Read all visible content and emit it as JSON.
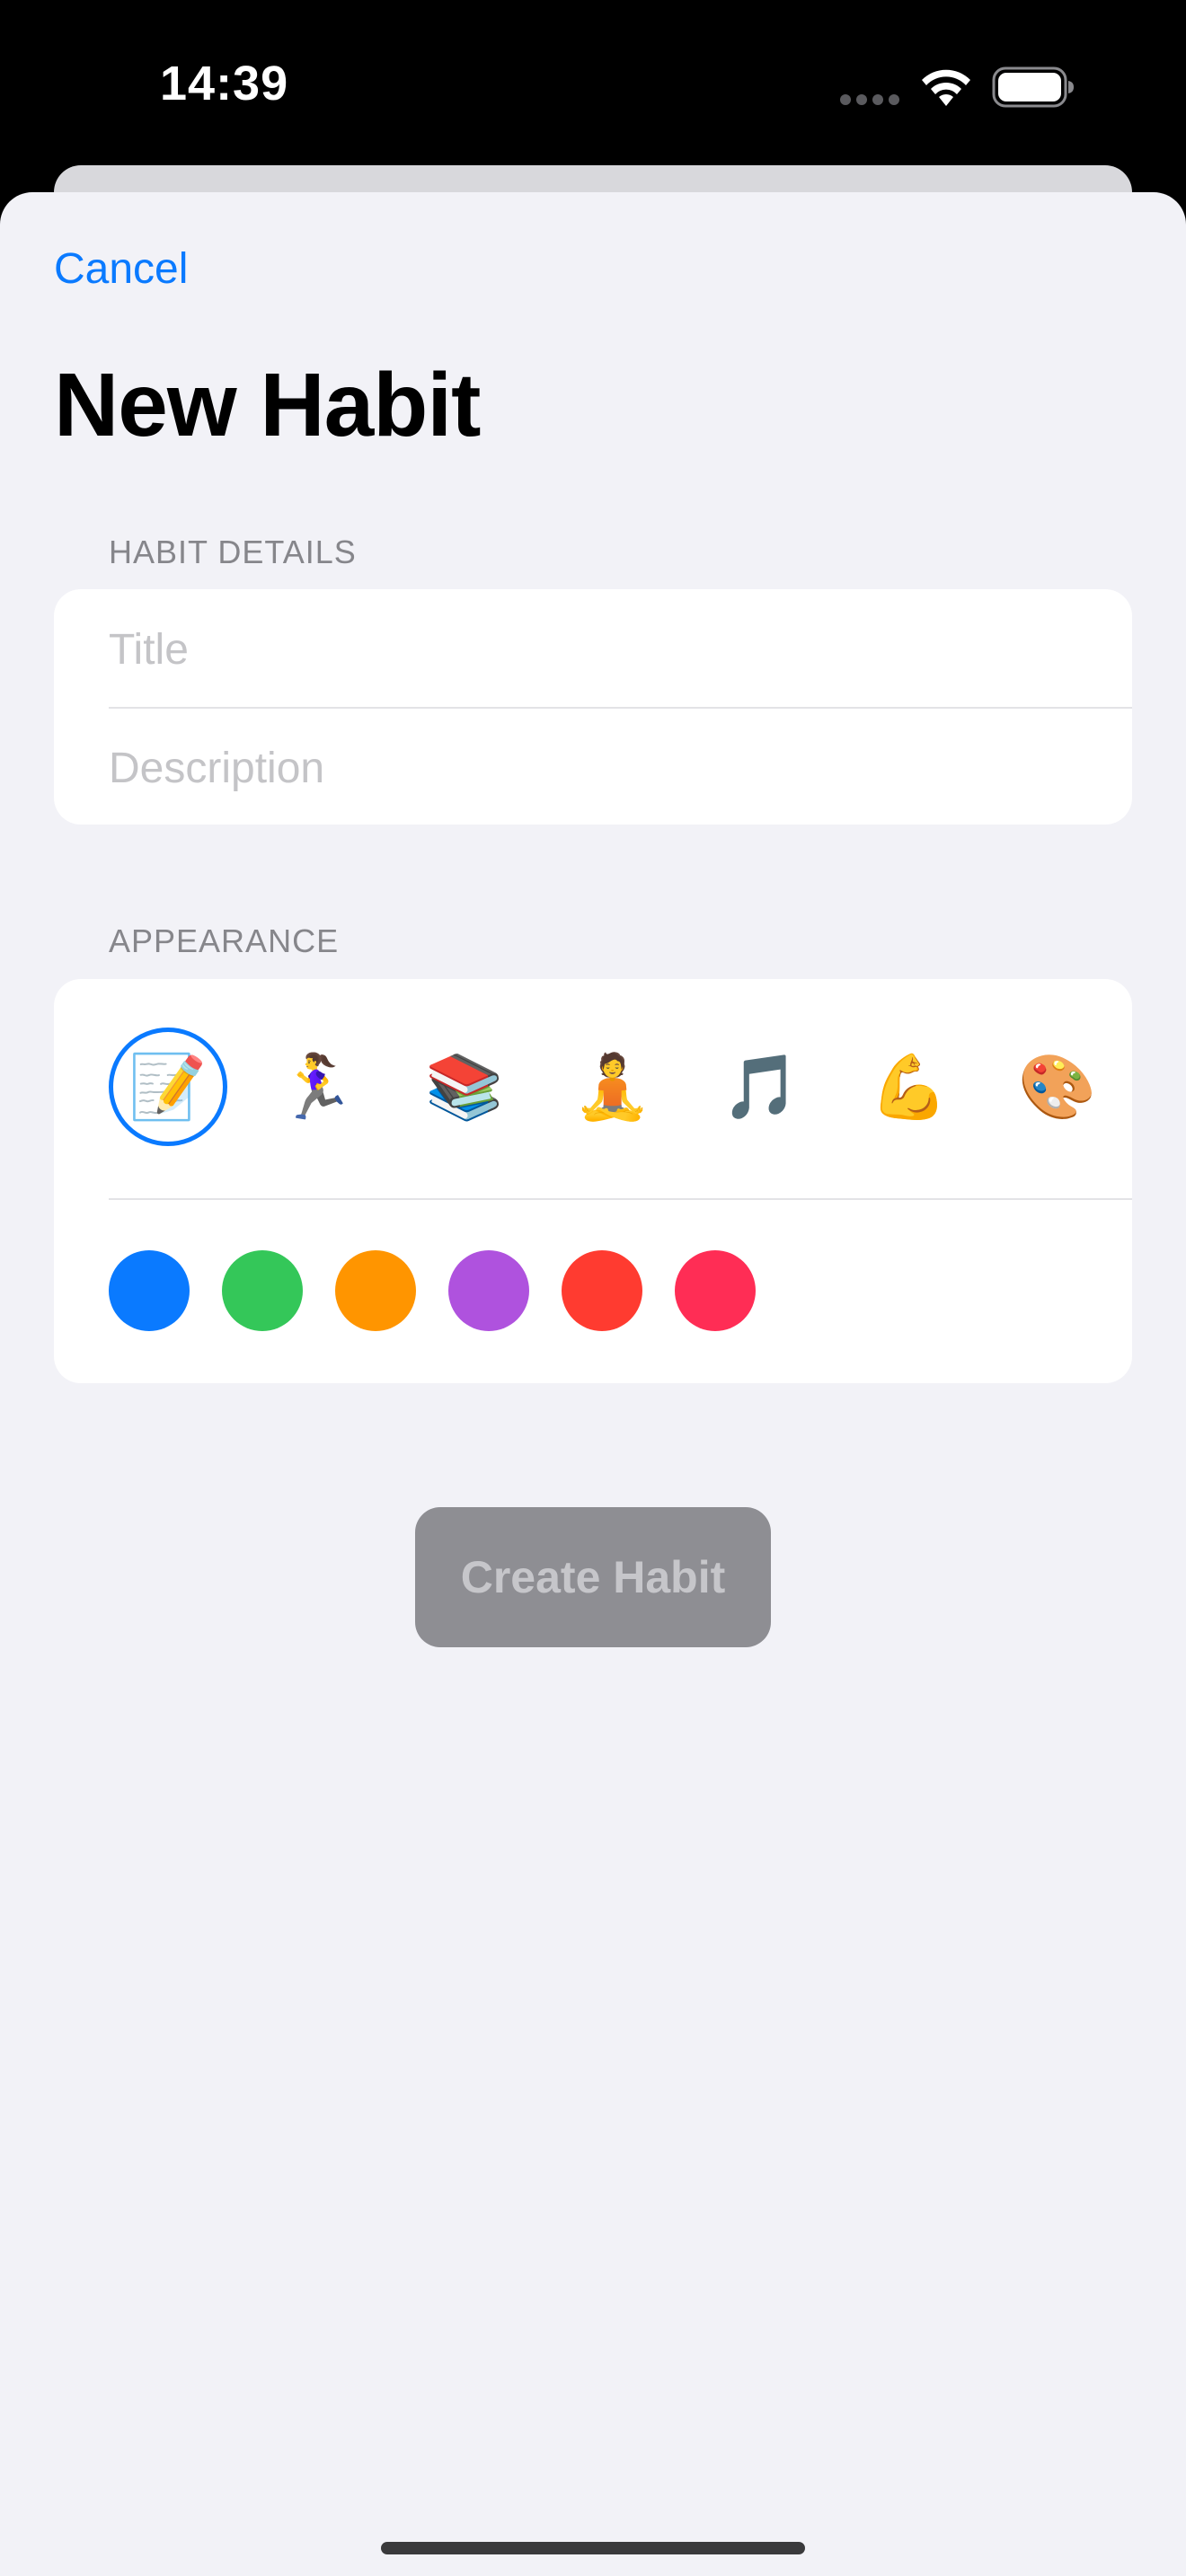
{
  "status_bar": {
    "time": "14:39"
  },
  "sheet": {
    "cancel_label": "Cancel",
    "title": "New Habit"
  },
  "habit_details": {
    "header": "HABIT DETAILS",
    "title_placeholder": "Title",
    "title_value": "",
    "description_placeholder": "Description",
    "description_value": ""
  },
  "appearance": {
    "header": "APPEARANCE",
    "emojis": [
      {
        "glyph": "📝",
        "icon": "memo-icon",
        "selected": true
      },
      {
        "glyph": "🏃‍♀️",
        "icon": "woman-running-icon",
        "selected": false
      },
      {
        "glyph": "📚",
        "icon": "books-icon",
        "selected": false
      },
      {
        "glyph": "🧘",
        "icon": "person-meditating-icon",
        "selected": false
      },
      {
        "glyph": "🎵",
        "icon": "musical-note-icon",
        "selected": false
      },
      {
        "glyph": "💪",
        "icon": "flexed-biceps-icon",
        "selected": false
      },
      {
        "glyph": "🎨",
        "icon": "artist-palette-icon",
        "selected": false
      }
    ],
    "colors": [
      {
        "name": "blue",
        "hex": "#0a7aff"
      },
      {
        "name": "green",
        "hex": "#34c759"
      },
      {
        "name": "orange",
        "hex": "#ff9500"
      },
      {
        "name": "purple",
        "hex": "#af52de"
      },
      {
        "name": "red",
        "hex": "#ff3b30"
      },
      {
        "name": "pink",
        "hex": "#ff2d55"
      }
    ]
  },
  "create_button": {
    "label": "Create Habit",
    "enabled": false
  },
  "theme": {
    "accent": "#0a7aff",
    "sheet_background": "#f2f2f7",
    "disabled_button": "#8e8e93"
  }
}
